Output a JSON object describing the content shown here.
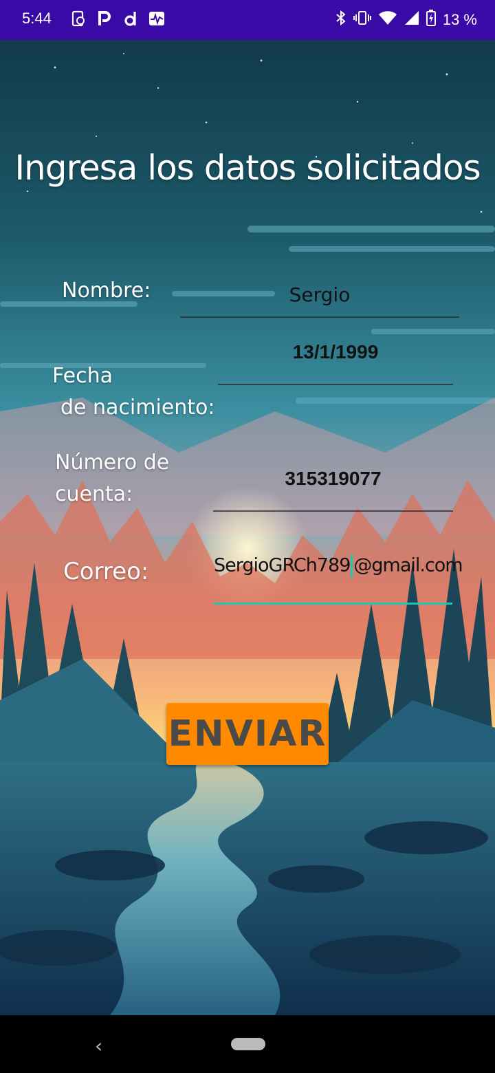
{
  "status_bar": {
    "time": "5:44",
    "left_icons": [
      "screen-record-icon",
      "parking-icon",
      "d-app-icon",
      "activity-icon"
    ],
    "right_icons": [
      "bluetooth-icon",
      "vibrate-icon",
      "wifi-icon",
      "signal-icon",
      "battery-charging-icon"
    ],
    "battery": "13 %"
  },
  "form": {
    "title": "Ingresa los datos solicitados",
    "nombre_label": "Nombre:",
    "nombre_value": "Sergio",
    "fecha_label_line1": "Fecha",
    "fecha_label_line2": "de nacimiento:",
    "fecha_value": "13/1/1999",
    "cuenta_label_line1": "Número de",
    "cuenta_label_line2": "cuenta:",
    "cuenta_value": "315319077",
    "correo_label": "Correo:",
    "correo_value_before_caret": "SergioGRCh789",
    "correo_value_after_caret": "@gmail.com",
    "submit_label": "ENVIAR"
  },
  "colors": {
    "status_bar": "#3a0aa6",
    "button": "#ff8a00",
    "active_underline": "#1ec9b4"
  }
}
